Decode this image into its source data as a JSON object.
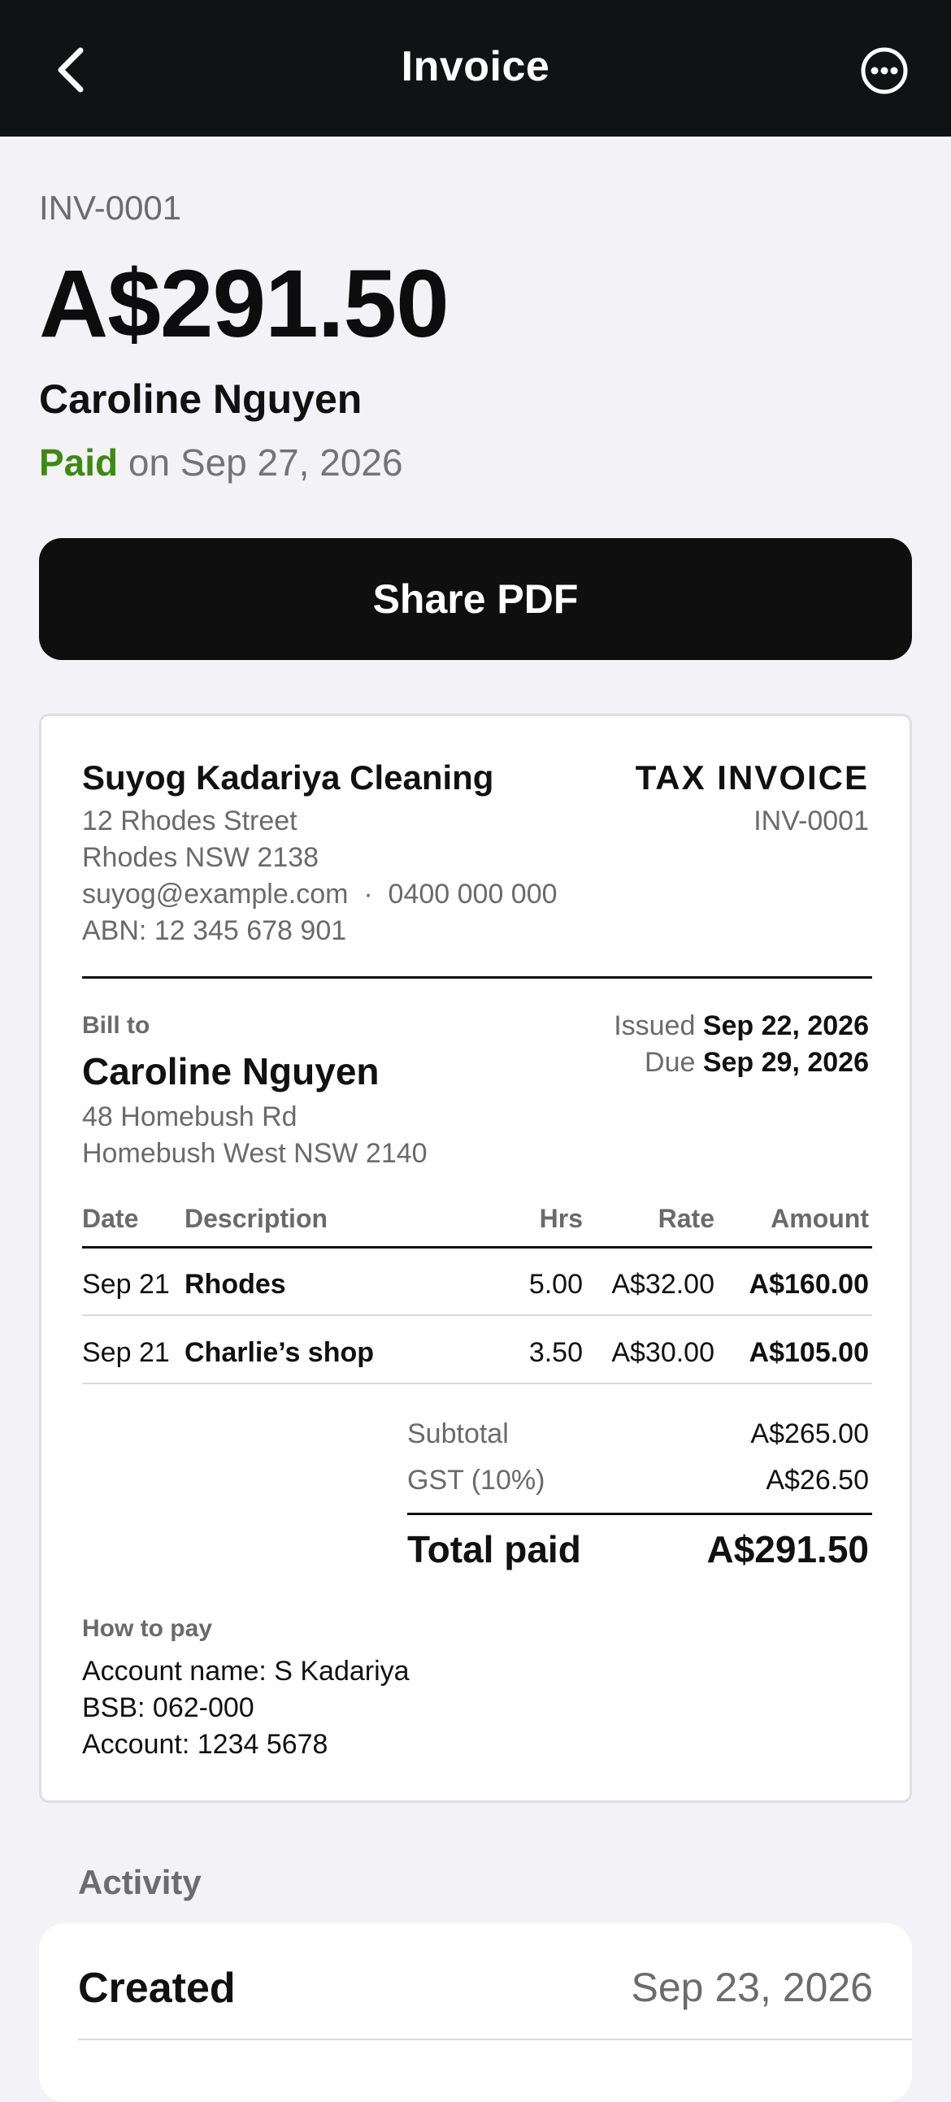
{
  "header": {
    "title": "Invoice",
    "back_icon": "chevron-left-icon",
    "more_icon": "ellipsis-circle-icon"
  },
  "summary": {
    "invoice_number": "INV-0001",
    "amount": "A$291.50",
    "client_name": "Caroline Nguyen",
    "status": "Paid",
    "status_suffix": " on Sep 27, 2026",
    "status_color": "#3d8a11"
  },
  "actions": {
    "share_label": "Share PDF"
  },
  "document": {
    "business": {
      "name": "Suyog Kadariya Cleaning",
      "address_1": "12 Rhodes Street",
      "address_2": "Rhodes NSW 2138",
      "contact": "suyog@example.com  ·  0400 000 000",
      "abn": "ABN: 12 345 678 901"
    },
    "doc_title": "TAX INVOICE",
    "doc_number": "INV-0001",
    "bill_to": {
      "label": "Bill to",
      "name": "Caroline Nguyen",
      "address_1": "48 Homebush Rd",
      "address_2": "Homebush West NSW 2140"
    },
    "issued_label": "Issued",
    "issued_date": "Sep 22, 2026",
    "due_label": "Due",
    "due_date": "Sep 29, 2026",
    "columns": {
      "date": "Date",
      "description": "Description",
      "hrs": "Hrs",
      "rate": "Rate",
      "amount": "Amount"
    },
    "rows": [
      {
        "date": "Sep 21",
        "description": "Rhodes",
        "hrs": "5.00",
        "rate": "A$32.00",
        "amount": "A$160.00"
      },
      {
        "date": "Sep 21",
        "description": "Charlie’s shop",
        "hrs": "3.50",
        "rate": "A$30.00",
        "amount": "A$105.00"
      }
    ],
    "totals": {
      "subtotal_label": "Subtotal",
      "subtotal": "A$265.00",
      "gst_label": "GST (10%)",
      "gst": "A$26.50",
      "total_label": "Total paid",
      "total": "A$291.50"
    },
    "payment": {
      "label": "How to pay",
      "account_name": "Account name: S Kadariya",
      "bsb": "BSB: 062-000",
      "account": "Account: 1234 5678"
    }
  },
  "activity": {
    "label": "Activity",
    "items": [
      {
        "event": "Created",
        "date": "Sep 23, 2026"
      }
    ]
  }
}
